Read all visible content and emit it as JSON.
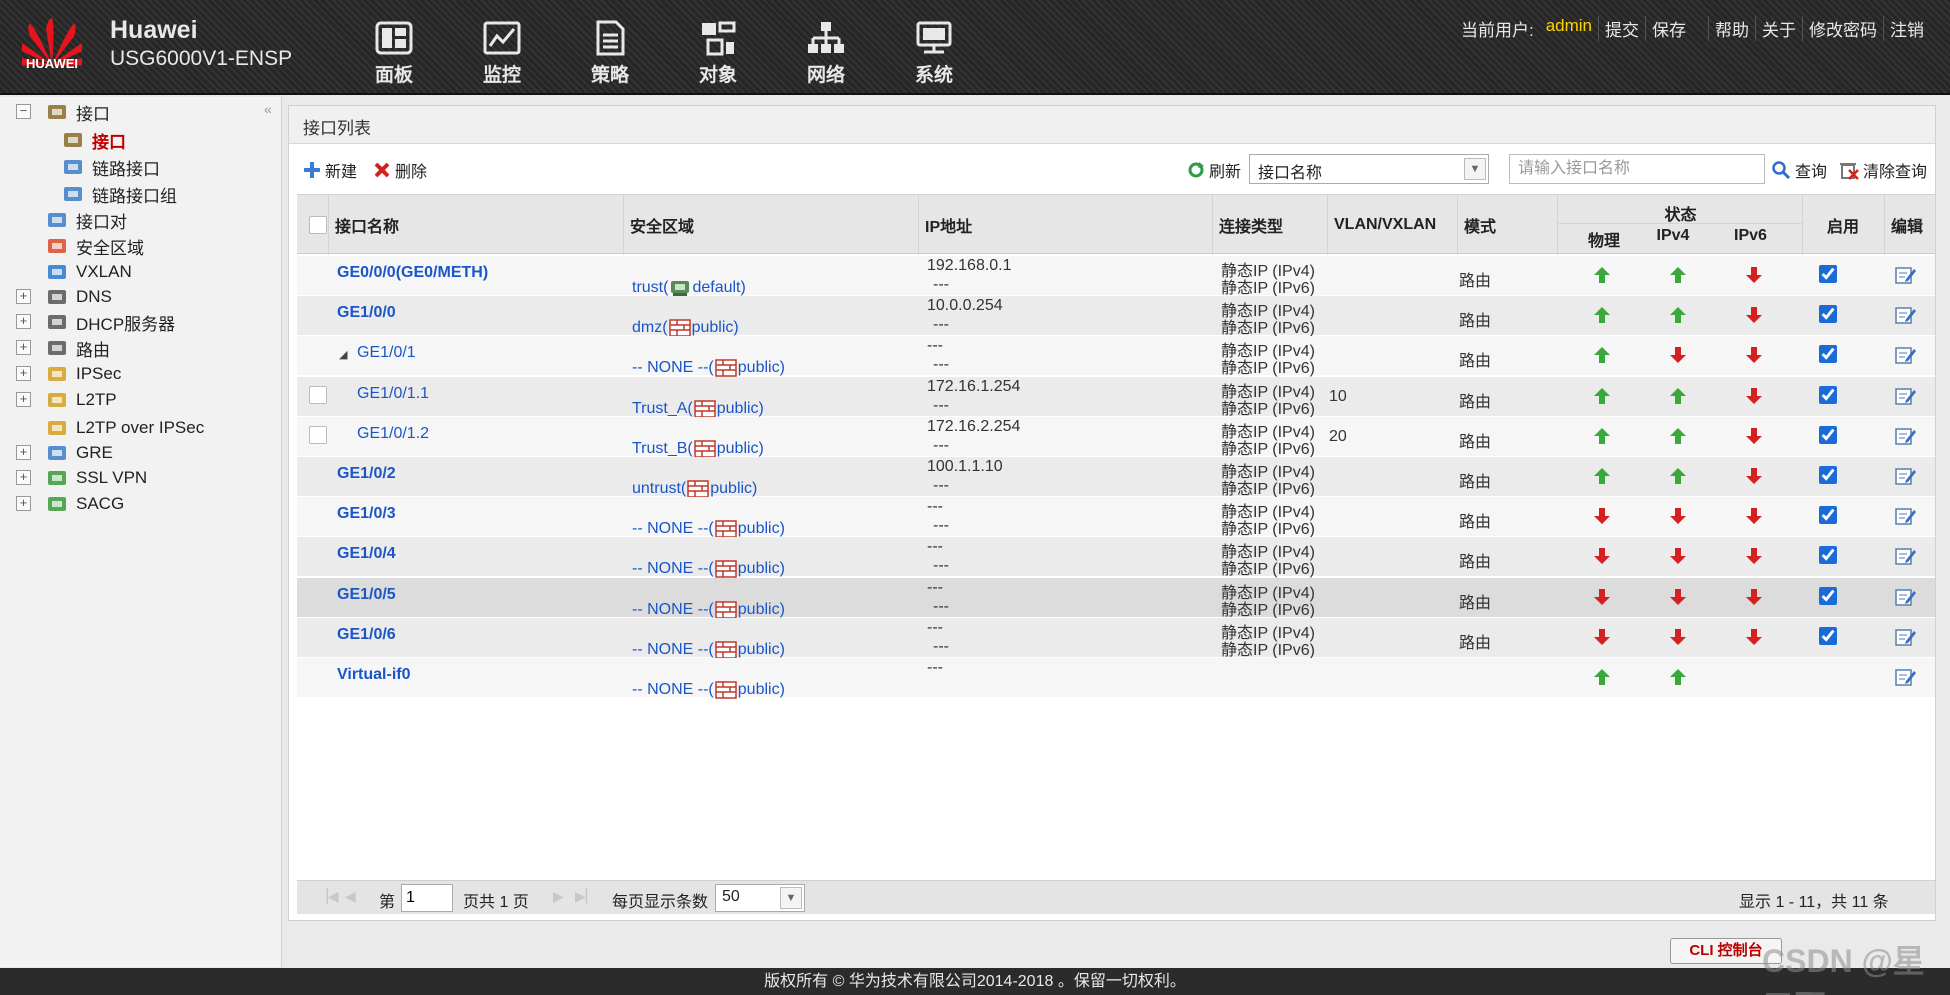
{
  "header": {
    "brand_name": "Huawei",
    "model": "USG6000V1-ENSP",
    "logo_text": "HUAWEI",
    "nav": [
      {
        "label": "面板",
        "icon": "dashboard-icon"
      },
      {
        "label": "监控",
        "icon": "monitor-icon"
      },
      {
        "label": "策略",
        "icon": "policy-icon"
      },
      {
        "label": "对象",
        "icon": "object-icon"
      },
      {
        "label": "网络",
        "icon": "network-icon"
      },
      {
        "label": "系统",
        "icon": "system-icon"
      }
    ],
    "current_user_label": "当前用户:",
    "current_user": "admin",
    "links": {
      "submit": "提交",
      "save": "保存",
      "help": "帮助",
      "about": "关于",
      "change_password": "修改密码",
      "logout": "注销"
    }
  },
  "sidebar": {
    "items": [
      {
        "label": "接口",
        "expander": "−",
        "icon": "interface-icon"
      },
      {
        "label": "接口",
        "icon": "interface-icon",
        "active": true
      },
      {
        "label": "链路接口",
        "icon": "link-interface-icon"
      },
      {
        "label": "链路接口组",
        "icon": "link-group-icon"
      },
      {
        "label": "接口对",
        "icon": "interface-pair-icon"
      },
      {
        "label": "安全区域",
        "icon": "security-zone-icon"
      },
      {
        "label": "VXLAN",
        "icon": "vxlan-icon"
      },
      {
        "label": "DNS",
        "expander": "+",
        "icon": "dns-icon"
      },
      {
        "label": "DHCP服务器",
        "expander": "+",
        "icon": "dhcp-icon"
      },
      {
        "label": "路由",
        "expander": "+",
        "icon": "route-icon"
      },
      {
        "label": "IPSec",
        "expander": "+",
        "icon": "ipsec-icon"
      },
      {
        "label": "L2TP",
        "expander": "+",
        "icon": "l2tp-icon"
      },
      {
        "label": "L2TP over IPSec",
        "icon": "l2tp-ipsec-icon"
      },
      {
        "label": "GRE",
        "expander": "+",
        "icon": "gre-icon"
      },
      {
        "label": "SSL VPN",
        "expander": "+",
        "icon": "sslvpn-icon"
      },
      {
        "label": "SACG",
        "expander": "+",
        "icon": "sacg-icon"
      }
    ]
  },
  "panel": {
    "title": "接口列表"
  },
  "toolbar": {
    "new_label": "新建",
    "delete_label": "删除",
    "refresh_label": "刷新",
    "search_field": "接口名称",
    "search_placeholder": "请输入接口名称",
    "query_label": "查询",
    "clear_label": "清除查询"
  },
  "table": {
    "headers": {
      "name": "接口名称",
      "zone": "安全区域",
      "ip": "IP地址",
      "conn_type": "连接类型",
      "vlan": "VLAN/VXLAN",
      "mode": "模式",
      "status": "状态",
      "physical": "物理",
      "ipv4": "IPv4",
      "ipv6": "IPv6",
      "enable": "启用",
      "edit": "编辑"
    },
    "rows": [
      {
        "name": "GE0/0/0(GE0/METH)",
        "zone_pre": "trust(",
        "zone_post": " default)",
        "ip1": "192.168.0.1",
        "ip2": "---",
        "ct1": "静态IP (IPv4)",
        "ct2": "静态IP (IPv6)",
        "vlan": "",
        "mode": "路由",
        "phy": "up",
        "v4": "up",
        "v6": "down",
        "enabled": true
      },
      {
        "name": "GE1/0/0",
        "zone_pre": "dmz(",
        "zone_post": " public)",
        "ip1": "10.0.0.254",
        "ip2": "---",
        "ct1": "静态IP (IPv4)",
        "ct2": "静态IP (IPv6)",
        "vlan": "",
        "mode": "路由",
        "phy": "up",
        "v4": "up",
        "v6": "down",
        "enabled": true
      },
      {
        "name": "GE1/0/1",
        "zone_pre": "-- NONE --(",
        "zone_post": " public)",
        "ip1": "---",
        "ip2": "---",
        "ct1": "静态IP (IPv4)",
        "ct2": "静态IP (IPv6)",
        "vlan": "",
        "mode": "路由",
        "phy": "up",
        "v4": "down",
        "v6": "down",
        "enabled": true
      },
      {
        "name": "GE1/0/1.1",
        "zone_pre": "Trust_A(",
        "zone_post": " public)",
        "ip1": "172.16.1.254",
        "ip2": "---",
        "ct1": "静态IP (IPv4)",
        "ct2": "静态IP (IPv6)",
        "vlan": "10",
        "mode": "路由",
        "phy": "up",
        "v4": "up",
        "v6": "down",
        "enabled": true
      },
      {
        "name": "GE1/0/1.2",
        "zone_pre": "Trust_B(",
        "zone_post": " public)",
        "ip1": "172.16.2.254",
        "ip2": "---",
        "ct1": "静态IP (IPv4)",
        "ct2": "静态IP (IPv6)",
        "vlan": "20",
        "mode": "路由",
        "phy": "up",
        "v4": "up",
        "v6": "down",
        "enabled": true
      },
      {
        "name": "GE1/0/2",
        "zone_pre": "untrust(",
        "zone_post": " public)",
        "ip1": "100.1.1.10",
        "ip2": "---",
        "ct1": "静态IP (IPv4)",
        "ct2": "静态IP (IPv6)",
        "vlan": "",
        "mode": "路由",
        "phy": "up",
        "v4": "up",
        "v6": "down",
        "enabled": true
      },
      {
        "name": "GE1/0/3",
        "zone_pre": "-- NONE --(",
        "zone_post": " public)",
        "ip1": "---",
        "ip2": "---",
        "ct1": "静态IP (IPv4)",
        "ct2": "静态IP (IPv6)",
        "vlan": "",
        "mode": "路由",
        "phy": "down",
        "v4": "down",
        "v6": "down",
        "enabled": true
      },
      {
        "name": "GE1/0/4",
        "zone_pre": "-- NONE --(",
        "zone_post": " public)",
        "ip1": "---",
        "ip2": "---",
        "ct1": "静态IP (IPv4)",
        "ct2": "静态IP (IPv6)",
        "vlan": "",
        "mode": "路由",
        "phy": "down",
        "v4": "down",
        "v6": "down",
        "enabled": true
      },
      {
        "name": "GE1/0/5",
        "zone_pre": "-- NONE --(",
        "zone_post": " public)",
        "ip1": "---",
        "ip2": "---",
        "ct1": "静态IP (IPv4)",
        "ct2": "静态IP (IPv6)",
        "vlan": "",
        "mode": "路由",
        "phy": "down",
        "v4": "down",
        "v6": "down",
        "enabled": true
      },
      {
        "name": "GE1/0/6",
        "zone_pre": "-- NONE --(",
        "zone_post": " public)",
        "ip1": "---",
        "ip2": "---",
        "ct1": "静态IP (IPv4)",
        "ct2": "静态IP (IPv6)",
        "vlan": "",
        "mode": "路由",
        "phy": "down",
        "v4": "down",
        "v6": "down",
        "enabled": true
      },
      {
        "name": "Virtual-if0",
        "zone_pre": "-- NONE --(",
        "zone_post": " public)",
        "ip1": "---",
        "ip2": "",
        "ct1": "",
        "ct2": "",
        "vlan": "",
        "mode": "",
        "phy": "up",
        "v4": "up",
        "v6": "",
        "enabled": false
      }
    ]
  },
  "pager": {
    "page_prefix": "第",
    "page": "1",
    "page_suffix": "页共 1 页",
    "per_page_label": "每页显示条数",
    "per_page": "50",
    "summary": "显示 1 - 11，共 11 条"
  },
  "cli_button": "CLI 控制台",
  "footer": "版权所有 © 华为技术有限公司2014-2018 。保留一切权利。",
  "watermark": "CSDN @星元野",
  "colors": {
    "link": "#1a56c8",
    "up": "#3aa83a",
    "down": "#d42020",
    "active_nav": "#c00000",
    "user": "#ffd400"
  }
}
